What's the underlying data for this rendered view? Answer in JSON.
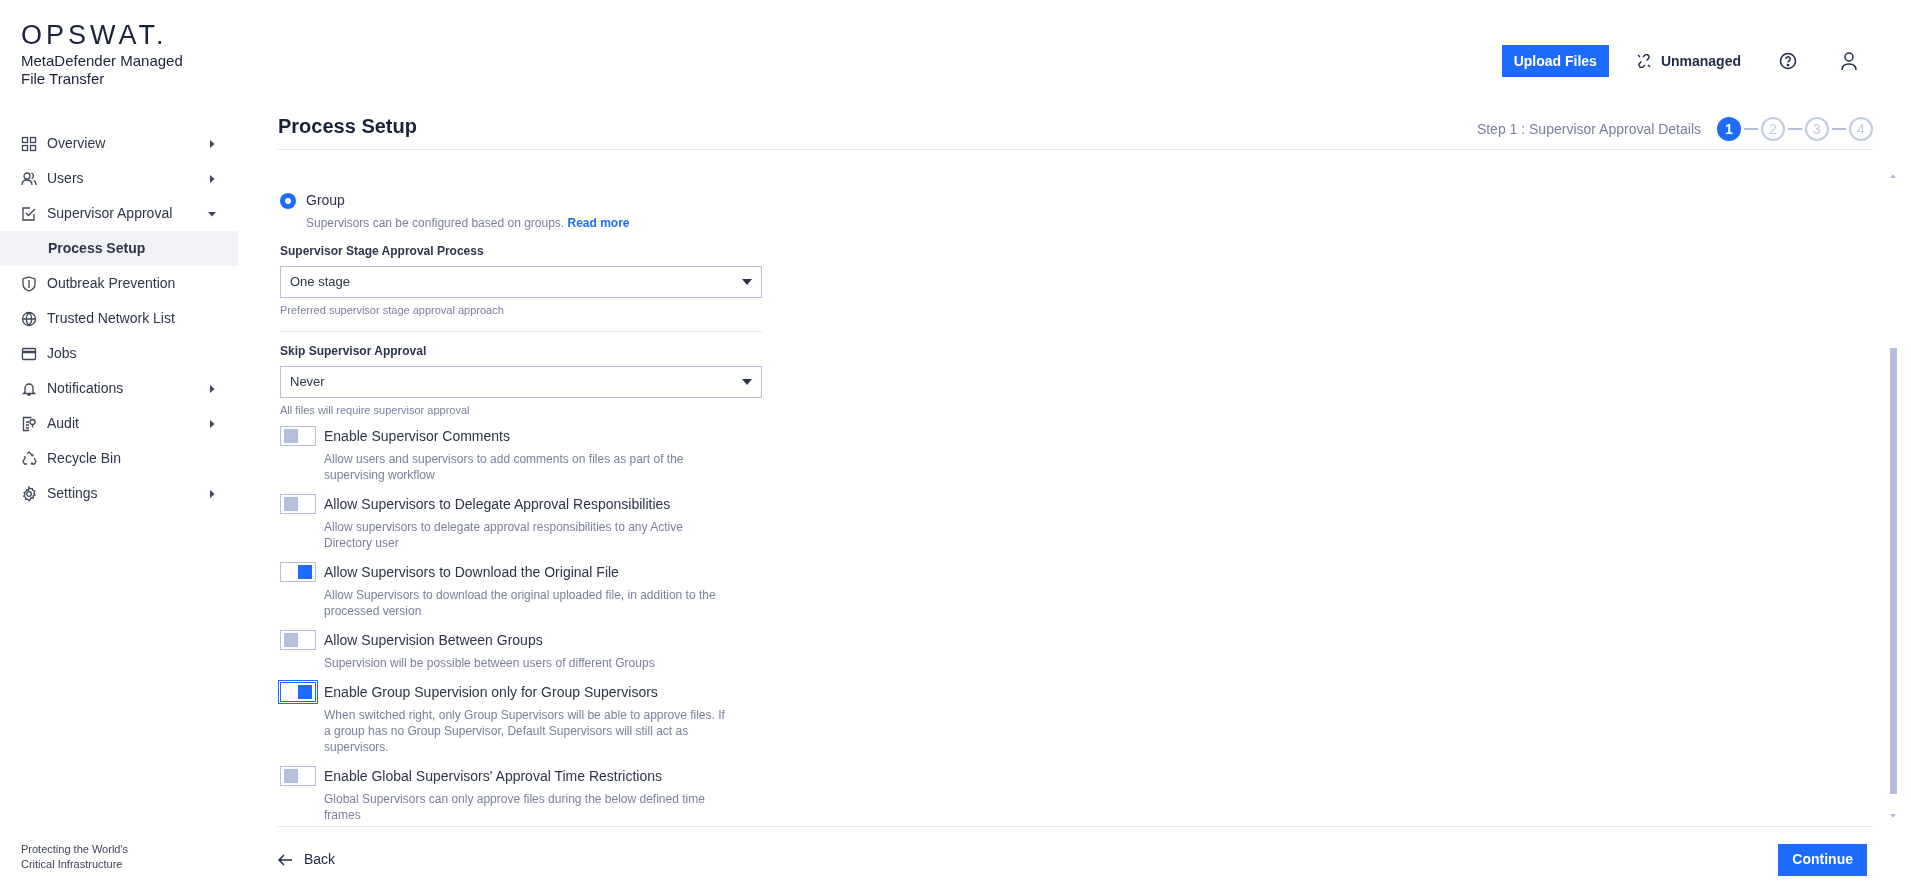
{
  "brand": {
    "logo": "OPSWAT.",
    "product": "MetaDefender Managed File Transfer",
    "tagline": "Protecting the World's Critical Infrastructure"
  },
  "sidebar": {
    "items": [
      {
        "label": "Overview",
        "kind": "group",
        "expanded": false,
        "selected": false
      },
      {
        "label": "Users",
        "kind": "group",
        "expanded": false,
        "selected": false
      },
      {
        "label": "Supervisor Approval",
        "kind": "group",
        "expanded": true,
        "selected": false,
        "children": [
          {
            "label": "Process Setup",
            "selected": true
          }
        ]
      },
      {
        "label": "Outbreak Prevention",
        "kind": "link",
        "selected": false
      },
      {
        "label": "Trusted Network List",
        "kind": "link",
        "selected": false
      },
      {
        "label": "Jobs",
        "kind": "link",
        "selected": false
      },
      {
        "label": "Notifications",
        "kind": "group",
        "expanded": false,
        "selected": false
      },
      {
        "label": "Audit",
        "kind": "group",
        "expanded": false,
        "selected": false
      },
      {
        "label": "Recycle Bin",
        "kind": "link",
        "selected": false
      },
      {
        "label": "Settings",
        "kind": "group",
        "expanded": false,
        "selected": false
      }
    ]
  },
  "header": {
    "upload_button": "Upload Files",
    "status": "Unmanaged"
  },
  "page": {
    "title": "Process Setup",
    "step_label": "Step 1 : Supervisor Approval Details",
    "steps": [
      {
        "label": "1",
        "selected": true
      },
      {
        "label": "2",
        "selected": false
      },
      {
        "label": "3",
        "selected": false
      },
      {
        "label": "4",
        "selected": false
      }
    ]
  },
  "form": {
    "radio": {
      "label": "Group",
      "selected": true,
      "description": "Supervisors can be configured based on groups. ",
      "link": "Read more"
    },
    "selects": [
      {
        "label": "Supervisor Stage Approval Process",
        "value": "One stage",
        "hint": "Preferred supervisor stage approval approach"
      },
      {
        "label": "Skip Supervisor Approval",
        "value": "Never",
        "hint": "All files will require supervisor approval"
      }
    ],
    "toggles": [
      {
        "label": "Enable Supervisor Comments",
        "description": "Allow users and supervisors to add comments on files as part of the supervising workflow",
        "on": false,
        "focused": false
      },
      {
        "label": "Allow Supervisors to Delegate Approval Responsibilities",
        "description": "Allow supervisors to delegate approval responsibilities to any Active Directory user",
        "on": false,
        "focused": false
      },
      {
        "label": "Allow Supervisors to Download the Original File",
        "description": "Allow Supervisors to download the original uploaded file, in addition to the processed version",
        "on": true,
        "focused": false
      },
      {
        "label": "Allow Supervision Between Groups",
        "description": "Supervision will be possible between users of different Groups",
        "on": false,
        "focused": false
      },
      {
        "label": "Enable Group Supervision only for Group Supervisors",
        "description": "When switched right, only Group Supervisors will be able to approve files. If a group has no Group Supervisor, Default Supervisors will still act as supervisors.",
        "on": true,
        "focused": true
      },
      {
        "label": "Enable Global Supervisors' Approval Time Restrictions",
        "description": "Global Supervisors can only approve files during the below defined time frames",
        "on": false,
        "focused": false
      }
    ]
  },
  "footer": {
    "back": "Back",
    "continue": "Continue"
  }
}
